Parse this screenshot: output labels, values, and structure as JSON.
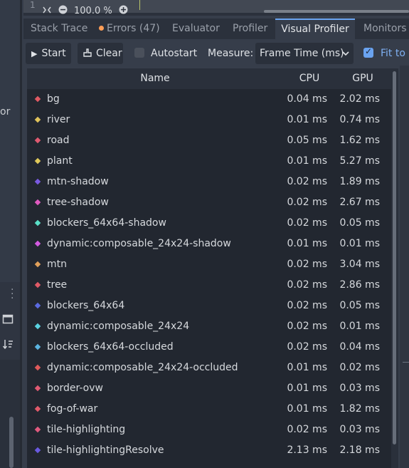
{
  "left_dock": {
    "partial_text": "or",
    "dock_icon": "window-icon",
    "sort_icon": "sort-icon"
  },
  "editor_strip": {
    "line_number": "1",
    "zoom": "100.0 %"
  },
  "tabs": [
    {
      "label": "Stack Trace"
    },
    {
      "label": "Errors (47)"
    },
    {
      "label": "Evaluator"
    },
    {
      "label": "Profiler"
    },
    {
      "label": "Visual Profiler"
    },
    {
      "label": "Monitors"
    }
  ],
  "toolbar": {
    "start_label": "Start",
    "clear_label": "Clear",
    "autostart_label": "Autostart",
    "measure_label": "Measure:",
    "measure_value": "Frame Time (ms)",
    "fit_label": "Fit to F"
  },
  "table": {
    "columns": [
      "Name",
      "CPU",
      "GPU"
    ],
    "rows": [
      {
        "name": "bg",
        "cpu": "0.04 ms",
        "gpu": "2.02 ms",
        "color": "#e05a63"
      },
      {
        "name": "river",
        "cpu": "0.01 ms",
        "gpu": "0.74 ms",
        "color": "#e0c25a"
      },
      {
        "name": "road",
        "cpu": "0.05 ms",
        "gpu": "1.62 ms",
        "color": "#e05a70"
      },
      {
        "name": "plant",
        "cpu": "0.01 ms",
        "gpu": "5.27 ms",
        "color": "#e0c95a"
      },
      {
        "name": "mtn-shadow",
        "cpu": "0.02 ms",
        "gpu": "1.89 ms",
        "color": "#7a5ae0"
      },
      {
        "name": "tree-shadow",
        "cpu": "0.02 ms",
        "gpu": "2.67 ms",
        "color": "#e05ac0"
      },
      {
        "name": "blockers_64x64-shadow",
        "cpu": "0.02 ms",
        "gpu": "0.05 ms",
        "color": "#5ae0c8"
      },
      {
        "name": "dynamic:composable_24x24-shadow",
        "cpu": "0.01 ms",
        "gpu": "0.01 ms",
        "color": "#d25ae0"
      },
      {
        "name": "mtn",
        "cpu": "0.02 ms",
        "gpu": "3.04 ms",
        "color": "#e0a05a"
      },
      {
        "name": "tree",
        "cpu": "0.02 ms",
        "gpu": "2.86 ms",
        "color": "#e05a66"
      },
      {
        "name": "blockers_64x64",
        "cpu": "0.02 ms",
        "gpu": "0.05 ms",
        "color": "#5a6ae0"
      },
      {
        "name": "dynamic:composable_24x24",
        "cpu": "0.02 ms",
        "gpu": "0.01 ms",
        "color": "#5ad2e0"
      },
      {
        "name": "blockers_64x64-occluded",
        "cpu": "0.02 ms",
        "gpu": "0.04 ms",
        "color": "#5ab4e0"
      },
      {
        "name": "dynamic:composable_24x24-occluded",
        "cpu": "0.01 ms",
        "gpu": "0.02 ms",
        "color": "#e05a5a"
      },
      {
        "name": "border-ovw",
        "cpu": "0.01 ms",
        "gpu": "0.03 ms",
        "color": "#e05a72"
      },
      {
        "name": "fog-of-war",
        "cpu": "0.01 ms",
        "gpu": "1.82 ms",
        "color": "#e05a6a"
      },
      {
        "name": "tile-highlighting",
        "cpu": "0.02 ms",
        "gpu": "0.03 ms",
        "color": "#e05a7e"
      },
      {
        "name": "tile-highlightingResolve",
        "cpu": "2.13 ms",
        "gpu": "2.18 ms",
        "color": "#6a5ae0"
      }
    ]
  }
}
